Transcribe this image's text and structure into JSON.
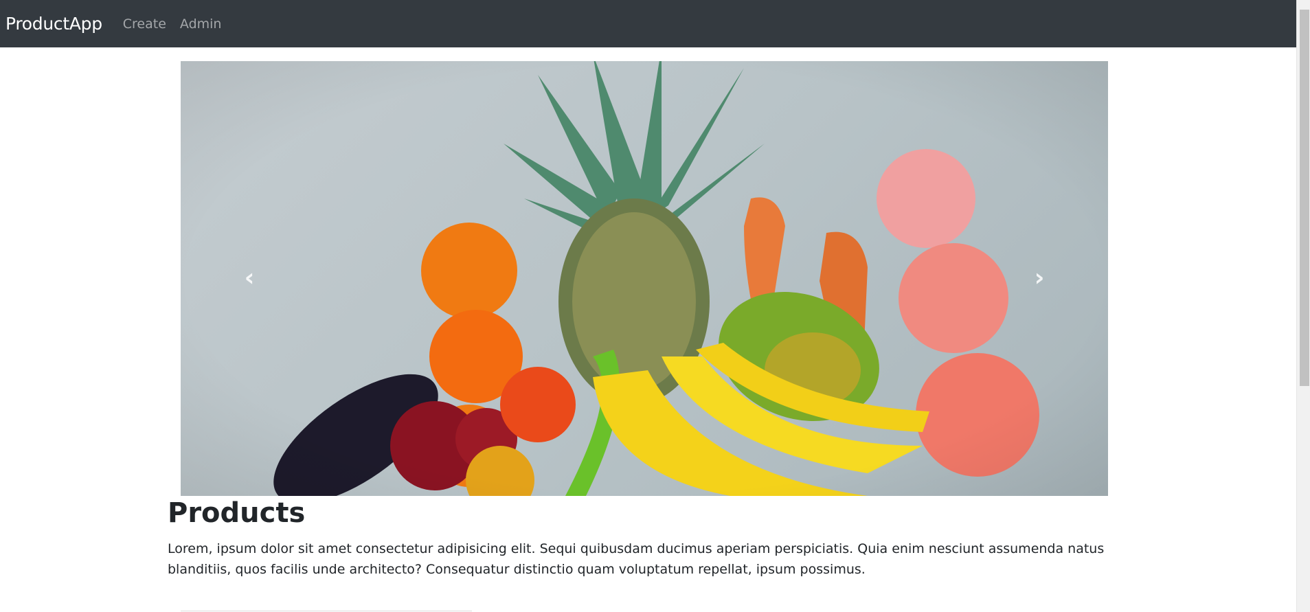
{
  "navbar": {
    "brand": "ProductApp",
    "links": [
      {
        "label": "Create"
      },
      {
        "label": "Admin"
      }
    ]
  },
  "carousel": {
    "image": "fruits-and-vegetables",
    "prev_icon": "chevron-left-icon",
    "next_icon": "chevron-right-icon"
  },
  "main": {
    "title": "Products",
    "description": "Lorem, ipsum dolor sit amet consectetur adipisicing elit. Sequi quibusdam ducimus aperiam perspiciatis. Quia enim nesciunt assumenda natus blanditiis, quos facilis unde architecto? Consequatur distinctio quam voluptatum repellat, ipsum possimus."
  },
  "colors": {
    "navbar_bg": "#343a40",
    "brand": "#ffffff",
    "nav_link": "#8c8f92"
  }
}
